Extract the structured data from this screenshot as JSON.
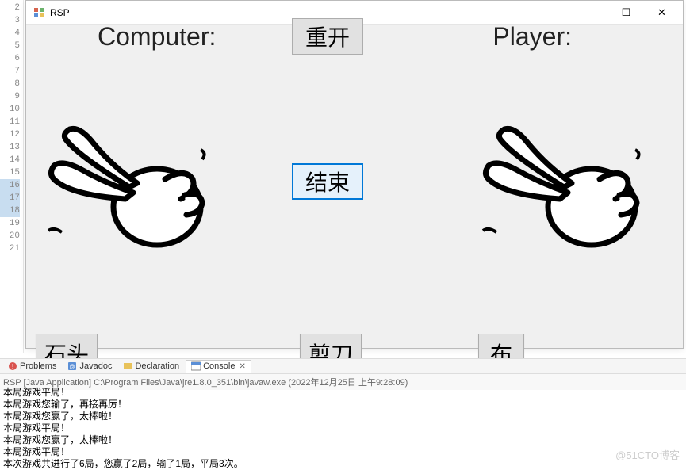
{
  "editor": {
    "lines": [
      "2",
      "3",
      "4",
      "5",
      "6",
      "7",
      "8",
      "9",
      "10",
      "11",
      "12",
      "13",
      "14",
      "15",
      "16",
      "17",
      "18",
      "19",
      "20",
      "21"
    ],
    "highlighted": [
      "16",
      "17",
      "18"
    ]
  },
  "window": {
    "title": "RSP",
    "minimize": "—",
    "maximize": "☐",
    "close": "✕"
  },
  "game": {
    "computer_label": "Computer:",
    "player_label": "Player:",
    "restart_label": "重开",
    "end_label": "结束",
    "rock_label": "石头",
    "scissors_label": "剪刀",
    "paper_label": "布"
  },
  "tabs": {
    "problems": "Problems",
    "javadoc": "Javadoc",
    "declaration": "Declaration",
    "console": "Console"
  },
  "console": {
    "header": "RSP [Java Application] C:\\Program Files\\Java\\jre1.8.0_351\\bin\\javaw.exe (2022年12月25日 上午9:28:09)",
    "lines": [
      "本局游戏平局！",
      "本局游戏您输了，再接再厉！",
      "本局游戏您赢了，太棒啦！",
      "本局游戏平局！",
      "本局游戏您赢了，太棒啦！",
      "本局游戏平局！",
      "本次游戏共进行了6局，您赢了2局，输了1局，平局3次。"
    ]
  },
  "watermark": "@51CTO博客"
}
